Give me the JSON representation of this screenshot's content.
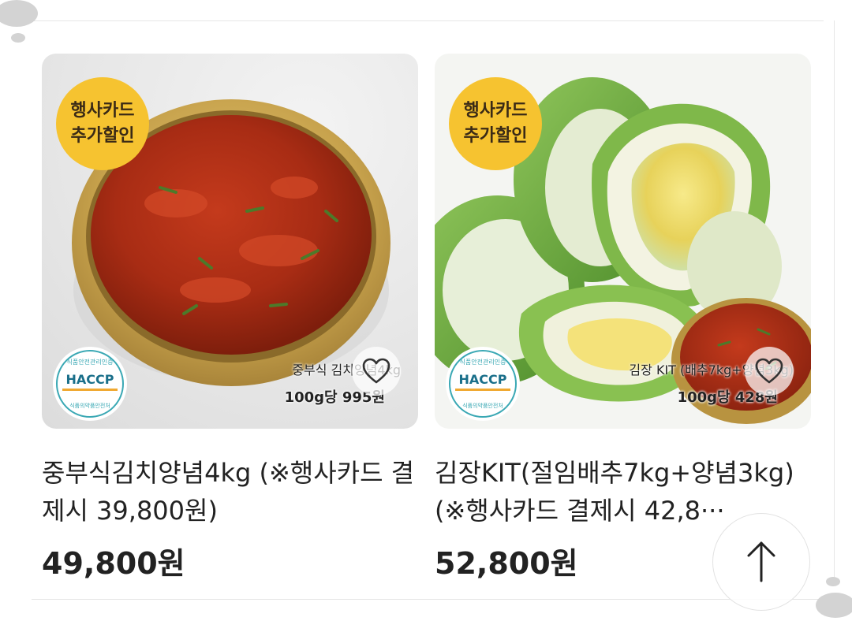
{
  "products": [
    {
      "badge_line1": "행사카드",
      "badge_line2": "추가할인",
      "overlay_name": "중부식 김치양념4kg",
      "overlay_price": "100g당 995원",
      "haccp_top": "식품안전관리인증",
      "haccp_main": "HACCP",
      "haccp_bottom": "식품의약품안전처",
      "title": "중부식김치양념4kg (※행사카드 결제시 39,800원)",
      "price": "49,800원",
      "icons": {
        "wishlist": "heart-outline-icon"
      }
    },
    {
      "badge_line1": "행사카드",
      "badge_line2": "추가할인",
      "overlay_name": "김장 KIT (배추7kg+양념3kg)",
      "overlay_price": "100g당 428원",
      "haccp_top": "식품안전관리인증",
      "haccp_main": "HACCP",
      "haccp_bottom": "식품의약품안전처",
      "title": "김장KIT(절임배추7kg+양념3kg) (※행사카드 결제시 42,8···",
      "price": "52,800원",
      "icons": {
        "wishlist": "heart-outline-icon"
      }
    }
  ],
  "scroll_top": {
    "icon": "arrow-up-icon"
  },
  "colors": {
    "badge": "#f6c330",
    "badge_text": "#3a2a16",
    "haccp": "#3aa8b4",
    "text": "#222222"
  }
}
